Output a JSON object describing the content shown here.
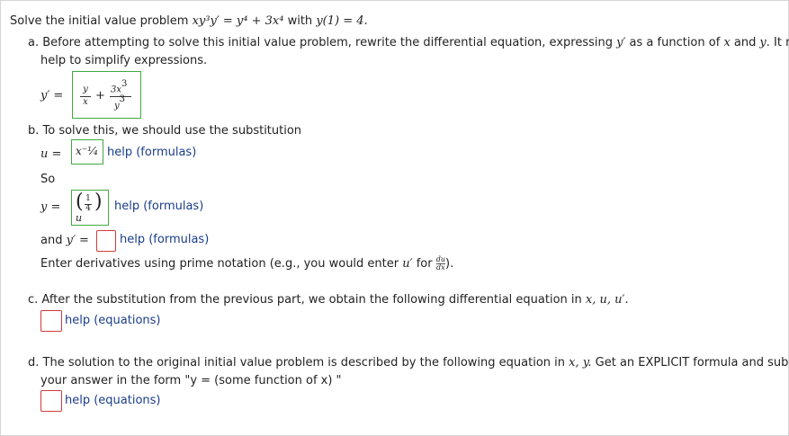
{
  "problem": {
    "intro": "Solve the initial value problem",
    "equation": "xy³y′ = y⁴ + 3x⁴",
    "with_word": "with",
    "condition": "y(1) = 4."
  },
  "part_a": {
    "text_1": "a. Before attempting to solve this initial value problem, rewrite the differential equation, expressing",
    "y_prime": "y′",
    "text_2": "as a function of",
    "x": "x",
    "and": "and",
    "y": "y",
    "text_3": ". It may",
    "text_4": "help to simplify expressions.",
    "answer_label": "y′ =",
    "answer": {
      "frac1_num": "y",
      "frac1_den": "x",
      "plus": "+",
      "frac2_num": "3x",
      "frac2_num_exp": "3",
      "frac2_den": "y",
      "frac2_den_exp": "3"
    }
  },
  "part_b": {
    "text": "b. To solve this, we should use the substitution",
    "u_label": "u =",
    "u_answer": "x⁻¹⁄₄",
    "help_1": "help (formulas)",
    "so": "So",
    "y_label": "y =",
    "y_answer_num": "1",
    "y_answer_den": "4",
    "y_answer_base": "u",
    "help_2": "help (formulas)",
    "yprime_label_1": "and",
    "yprime_label_2": "y′ =",
    "yprime_value": "",
    "help_3": "help (formulas)",
    "note_1": "Enter derivatives using prime notation (e.g., you would enter",
    "note_u": "u′",
    "note_for": "for",
    "note_frac_num": "du",
    "note_frac_den": "dx",
    "note_end": ")."
  },
  "part_c": {
    "text": "c. After the substitution from the previous part, we obtain the following differential equation in",
    "vars": "x, u, u′.",
    "value": "",
    "help": "help (equations)"
  },
  "part_d": {
    "text_1": "d. The solution to the original initial value problem is described by the following equation in",
    "vars": "x, y.",
    "text_2": "Get an EXPLICIT formula and submit",
    "text_3": "your answer in the form \"y = (some function of x) \"",
    "value": "",
    "help": "help (equations)"
  },
  "colors": {
    "correct_border": "#3fa93f",
    "empty_border": "#d13b3b",
    "link": "#1a3e8a"
  }
}
